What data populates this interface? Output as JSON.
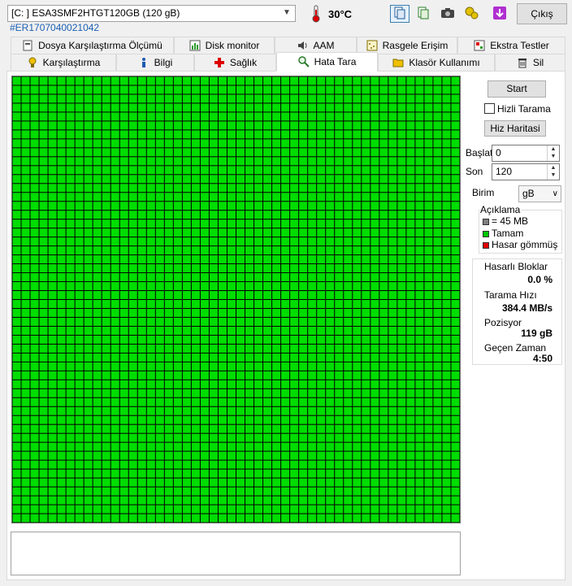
{
  "toolbar": {
    "drive": "[C: ] ESA3SMF2HTGT120GB (120 gB)",
    "serial": "#ER1707040021042",
    "temperature": "30°C",
    "exit_label": "Çıkış"
  },
  "tabs_top": [
    {
      "label": "Dosya Karşılaştırma Ölçümü",
      "icon": "file-compare-icon"
    },
    {
      "label": "Disk monitor",
      "icon": "chart-icon"
    },
    {
      "label": "AAM",
      "icon": "speaker-icon"
    },
    {
      "label": "Rasgele Erişim",
      "icon": "random-access-icon"
    },
    {
      "label": "Ekstra Testler",
      "icon": "extra-tests-icon"
    }
  ],
  "tabs_bottom": [
    {
      "label": "Karşılaştırma",
      "icon": "benchmark-icon"
    },
    {
      "label": "Bilgi",
      "icon": "info-icon"
    },
    {
      "label": "Sağlık",
      "icon": "health-cross-icon"
    },
    {
      "label": "Hata Tara",
      "icon": "magnifier-icon",
      "selected": true
    },
    {
      "label": "Klasör Kullanımı",
      "icon": "folder-icon"
    },
    {
      "label": "Sil",
      "icon": "trash-icon"
    }
  ],
  "scan": {
    "start_label": "Start",
    "quick_scan_label": "Hizli Tarama",
    "quick_scan_checked": false,
    "speed_map_label": "Hiz Haritasi",
    "start_pos_label": "Başlat",
    "start_pos_value": "0",
    "end_pos_label": "Son",
    "end_pos_value": "120",
    "unit_label": "Birim",
    "unit_value": "gB",
    "legend_title": "Açıklama",
    "legend": [
      {
        "label": "= 45 MB",
        "color": "#808080"
      },
      {
        "label": "Tamam",
        "color": "#00c800"
      },
      {
        "label": "Hasar gömmüş",
        "color": "#e00000"
      }
    ],
    "stats": {
      "damaged_label": "Hasarlı Bloklar",
      "damaged_value": "0.0 %",
      "speed_label": "Tarama Hızı",
      "speed_value": "384.4 MB/s",
      "position_label": "Pozisyor",
      "position_value": "119 gB",
      "elapsed_label": "Geçen Zaman",
      "elapsed_value": "4:50"
    }
  },
  "block_map": {
    "cols": 50,
    "rows": 50,
    "ok_color": "#00dd00",
    "ok_fraction": 1.0
  }
}
